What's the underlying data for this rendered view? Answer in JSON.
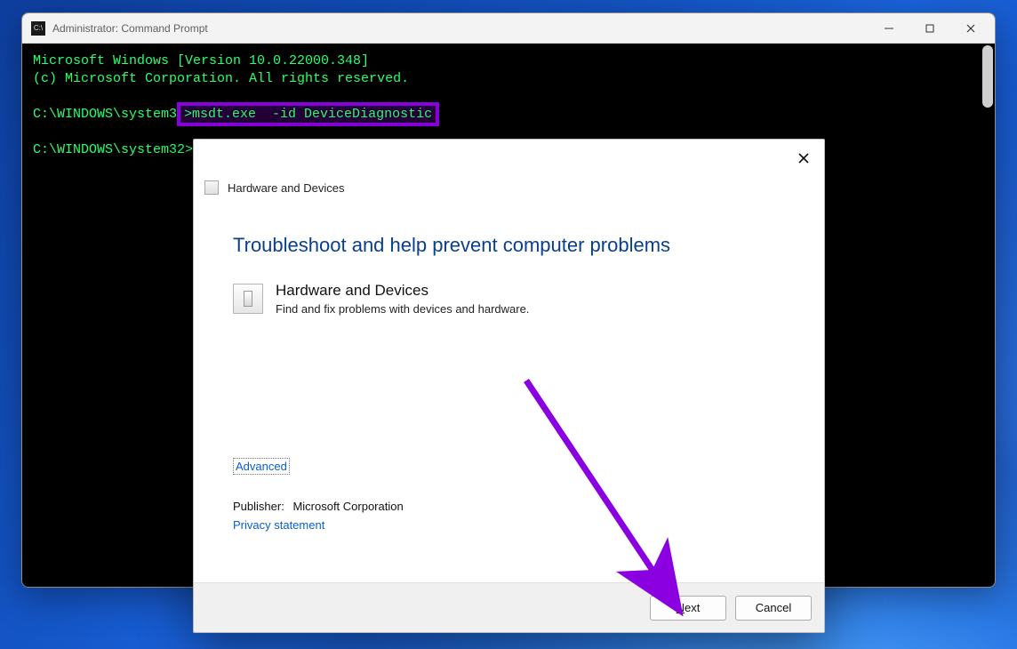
{
  "window": {
    "title": "Administrator: Command Prompt",
    "icon_label": "C:\\"
  },
  "terminal": {
    "line1": "Microsoft Windows [Version 10.0.22000.348]",
    "line2": "(c) Microsoft Corporation. All rights reserved.",
    "prompt1_prefix": "C:\\WINDOWS\\system3",
    "prompt1_cmd": ">msdt.exe  -id DeviceDiagnostic",
    "prompt2": "C:\\WINDOWS\\system32>"
  },
  "dialog": {
    "header_title": "Hardware and Devices",
    "heading": "Troubleshoot and help prevent computer problems",
    "item_title": "Hardware and Devices",
    "item_desc": "Find and fix problems with devices and hardware.",
    "advanced": "Advanced",
    "publisher_label": "Publisher:",
    "publisher_value": "Microsoft Corporation",
    "privacy": "Privacy statement",
    "next_prefix": "N",
    "next_rest": "ext",
    "cancel": "Cancel"
  }
}
